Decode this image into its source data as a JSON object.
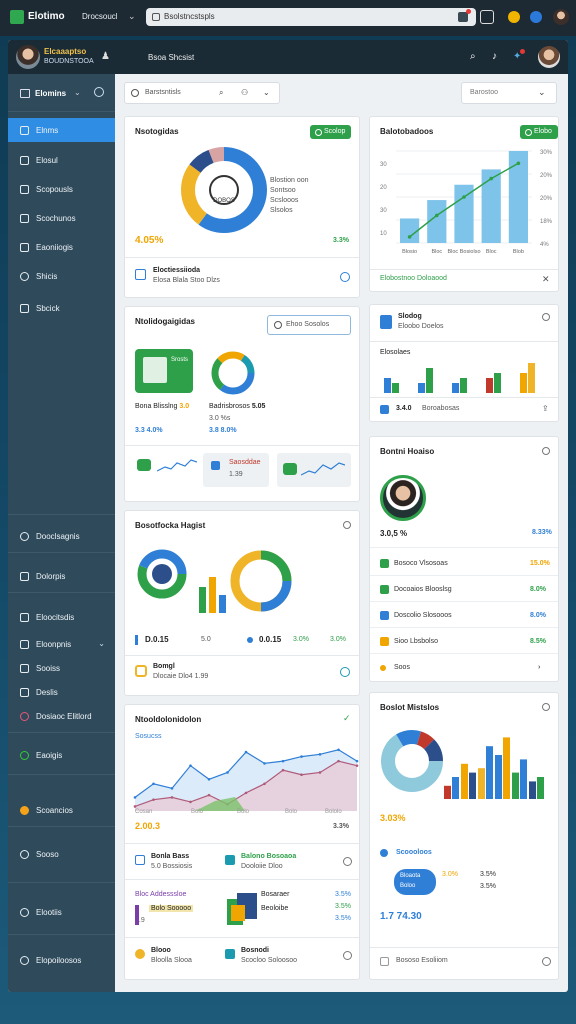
{
  "browser": {
    "title": "Elotimo",
    "subtitle": "Drocsoucl",
    "url": "Bsolstncstspls"
  },
  "topbar": {
    "user_name": "Elcaaaptso",
    "user_role": "BOUDNSTOOA",
    "page_label": "Bsoa Shcsist"
  },
  "sidebar": {
    "header": "Elomins",
    "items": [
      {
        "label": "Elnms"
      },
      {
        "label": "Elosul"
      },
      {
        "label": "Scopousls"
      },
      {
        "label": "Scochunos"
      },
      {
        "label": "Eaoniiogis"
      },
      {
        "label": "Shicis"
      },
      {
        "label": "Sbcick"
      },
      {
        "label": "Dooclsagnis"
      },
      {
        "label": "Dolorpis"
      },
      {
        "label": "Eloocitsdis"
      },
      {
        "label": "Eloonpnis"
      },
      {
        "label": "Sooiss"
      },
      {
        "label": "Deslis"
      },
      {
        "label": "Dosiaoc Elitlord"
      },
      {
        "label": "Eaoigis"
      },
      {
        "label": "Scoancios"
      },
      {
        "label": "Sooso"
      },
      {
        "label": "Elootiis"
      },
      {
        "label": "Elopoiloosos"
      }
    ]
  },
  "toolbar": {
    "search_placeholder": "Barstsntisls",
    "select_value": "Barostoo"
  },
  "cards": {
    "overview": {
      "title": "Nsotogidas",
      "button": "Scolop",
      "center_label": "DOBOS",
      "legend": [
        "Blostion oon",
        "Sontsoo",
        "Scslooos",
        "Slsolos"
      ],
      "value_left": "4.05%",
      "value_right": "3.3%",
      "footer_title": "Eloctiessiioda",
      "footer_sub": "Elosa Blala Stoo Dlzs"
    },
    "analytics": {
      "title": "Balotobadoos",
      "button": "Elobo",
      "footer": "Elobostnoo Doloaood",
      "y_right": [
        "30%",
        "20%",
        "20%",
        "18%",
        "4%"
      ],
      "y_left": [
        "30",
        "20",
        "30",
        "10"
      ],
      "x": [
        "Blosio",
        "Bloc",
        "Bloc Bosiolso",
        "Bloc",
        "Blob"
      ]
    },
    "widgets": {
      "title": "Ntolidogaigidas",
      "search_placeholder": "Ehoo Sosolos",
      "tile1_head": "Srosts",
      "tile1_label": "Bona Blisslng",
      "tile1_value": "3.0",
      "tile1_pct": "3.3 4.0%",
      "tile2_label": "Badrisbrosos",
      "tile2_value": "5.05",
      "tile2_sub": "3.0 %s",
      "tile2_pct": "3.8 8.0%",
      "mini_label": "Saosddae",
      "mini_value": "1.39"
    },
    "bar_small": {
      "title": "Slodog",
      "subtitle": "Eloobo Doelos",
      "legend_title": "Elosolaes",
      "foot_value": "3.4.0",
      "foot_label": "Boroabosas"
    },
    "profile": {
      "title": "Bontni Hoaiso",
      "percent": "3.0,5 %",
      "percent_right": "8.33%",
      "rows": [
        {
          "label": "Bosoco Vlsosoas",
          "value": "15.0%"
        },
        {
          "label": "Docoaios Blooslsg",
          "value": "8.0%"
        },
        {
          "label": "Doscolio Slosooos",
          "value": "8.0%"
        },
        {
          "label": "Sioo Lbsbolso",
          "value": "8.5%"
        },
        {
          "label": "Soos",
          "value": ""
        }
      ]
    },
    "projects": {
      "title": "Bosotfocka Hagist",
      "stat1_value": "D.0.15",
      "stat1_label": "5.0",
      "stat2_value": "0.0.15",
      "stat2_label": "3.0%",
      "stat3": "3.0%",
      "footer_title": "Bomgl",
      "footer_sub": "Dlocaie Dlo4 1.99"
    },
    "trend": {
      "title": "Ntooldolonidolon",
      "series_label": "Sosucss",
      "x": [
        "Cosan",
        "Bolo",
        "Bolo",
        "Bolo",
        "Bololo"
      ],
      "y": [
        "30%",
        "10",
        "20",
        "10"
      ],
      "value": "2.00.3",
      "value_right": "3.3%",
      "detail1_title": "Bonla Bass",
      "detail1_sub": "5.0 Bossiosis",
      "detail2_title": "Balono Bosoaoa",
      "detail2_sub": "Dooloiie Dloo",
      "item3_label": "Bloc Addesssloe",
      "item3_value": "3.5%",
      "item4_label": "Bosaraer",
      "item4_value": "3.5%",
      "item5_label": "Bolo Sooooo",
      "item5_value": "3.9",
      "item6_label": "Beoloibe",
      "item6_value": "3.5%",
      "foot1_title": "Blooo",
      "foot1_sub": "Bloolla Slooa",
      "foot2_title": "Bosnodi",
      "foot2_sub": "Scocloo Soloosoo"
    },
    "forecast": {
      "title": "Boslot Mistslos",
      "value": "3.03%",
      "subtitle": "Scoooloos",
      "bubble1": "Bloaota",
      "bubble2": "Boloo",
      "bubble_tags": [
        "3.0%",
        "3.5%",
        "3.5%"
      ],
      "value2": "1.7 74.30",
      "footer": "Bososo Esoliiom"
    }
  },
  "chart_data": [
    {
      "type": "pie",
      "categories": [
        "Blostion oon",
        "Sontsoo",
        "Scslooos",
        "Slsolos"
      ],
      "values": [
        60,
        25,
        9,
        6
      ],
      "colors": [
        "#2f7fd6",
        "#f0b429",
        "#2c4f8c",
        "#d7a3a3"
      ]
    },
    {
      "type": "bar",
      "categories": [
        "Blosio",
        "Bloc",
        "Bloc Bosiolso",
        "Bloc",
        "Blob"
      ],
      "values": [
        8,
        14,
        19,
        24,
        30
      ],
      "line": [
        2,
        9,
        15,
        21,
        26
      ],
      "ylim": [
        0,
        30
      ]
    },
    {
      "type": "bar",
      "categories": [
        "a",
        "b",
        "c",
        "d",
        "e"
      ],
      "series": [
        {
          "values": [
            3,
            2,
            2,
            3,
            4
          ]
        },
        {
          "values": [
            2,
            5,
            3,
            4,
            6
          ]
        }
      ]
    },
    {
      "type": "area",
      "x": [
        0,
        1,
        2,
        3,
        4,
        5,
        6,
        7,
        8,
        9,
        10,
        11,
        12
      ],
      "series": [
        {
          "values": [
            6,
            12,
            10,
            20,
            14,
            17,
            26,
            21,
            22,
            24,
            25,
            27,
            22
          ]
        },
        {
          "values": [
            2,
            5,
            6,
            4,
            7,
            3,
            8,
            12,
            18,
            16,
            17,
            22,
            20
          ]
        }
      ],
      "ylim": [
        0,
        30
      ]
    },
    {
      "type": "bar",
      "categories": [
        "a",
        "b",
        "c",
        "d",
        "e",
        "f"
      ],
      "series": [
        {
          "values": [
            3,
            8,
            7,
            10,
            6,
            4
          ]
        },
        {
          "values": [
            5,
            6,
            12,
            14,
            9,
            5
          ]
        }
      ]
    }
  ]
}
